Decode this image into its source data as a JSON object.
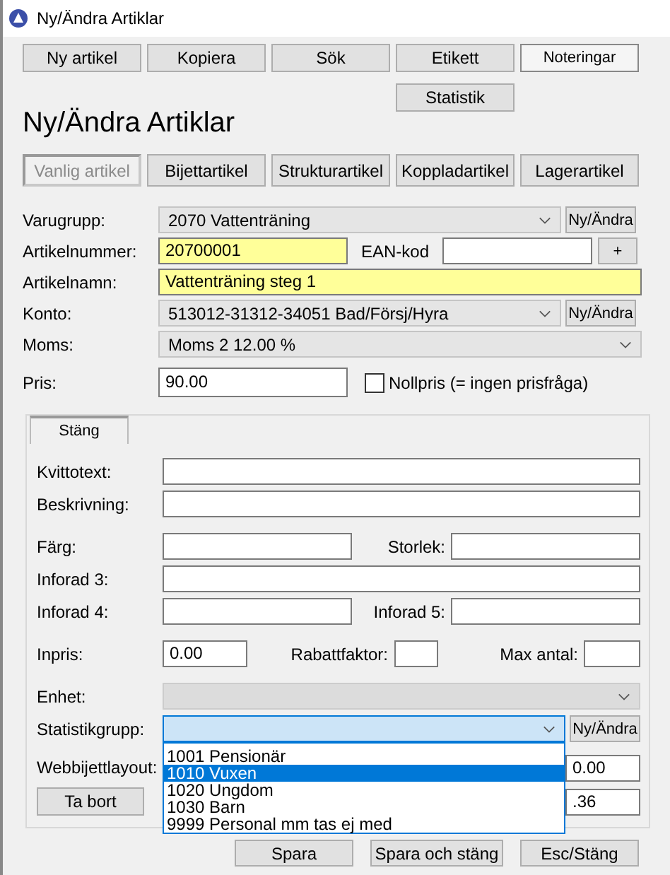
{
  "window": {
    "title": "Ny/Ändra Artiklar"
  },
  "toolbar": [
    {
      "label": "Ny artikel"
    },
    {
      "label": "Kopiera"
    },
    {
      "label": "Sök"
    },
    {
      "label": "Etikett"
    },
    {
      "label": "Noteringar"
    }
  ],
  "statistik_button": "Statistik",
  "heading": "Ny/Ändra Artiklar",
  "tabs": [
    {
      "label": "Vanlig artikel",
      "selected": true
    },
    {
      "label": "Bijettartikel",
      "selected": false
    },
    {
      "label": "Strukturartikel",
      "selected": false
    },
    {
      "label": "Koppladartikel",
      "selected": false
    },
    {
      "label": "Lagerartikel",
      "selected": false
    }
  ],
  "form": {
    "varugrupp": {
      "label": "Varugrupp:",
      "value": "2070 Vattenträning",
      "button": "Ny/Ändra"
    },
    "artikelnummer": {
      "label": "Artikelnummer:",
      "value": "20700001",
      "highlighted": true
    },
    "ean": {
      "label": "EAN-kod",
      "button": "+",
      "highlighted": false
    },
    "artikelnamn": {
      "label": "Artikelnamn:",
      "value": "Vattenträning steg 1",
      "highlighted": true
    },
    "konto": {
      "label": "Konto:",
      "value": "513012-31312-34051 Bad/Försj/Hyra",
      "button": "Ny/Ändra"
    },
    "moms": {
      "label": "Moms:",
      "value": "Moms 2 12.00 %"
    },
    "pris": {
      "label": "Pris:",
      "value": "90.00",
      "highlighted": false
    },
    "nollpris": {
      "label": "Nollpris (= ingen prisfråga)",
      "checked": false
    }
  },
  "panel": {
    "tab": "Stäng",
    "kvittotext": {
      "label": "Kvittotext:"
    },
    "beskrivning": {
      "label": "Beskrivning:"
    },
    "farg": {
      "label": "Färg:"
    },
    "storlek": {
      "label": "Storlek:"
    },
    "inforad3": {
      "label": "Inforad 3:"
    },
    "inforad4": {
      "label": "Inforad 4:"
    },
    "inforad5": {
      "label": "Inforad 5:"
    },
    "inpris": {
      "label": "Inpris:",
      "value": "0.00"
    },
    "rabattfaktor": {
      "label": "Rabattfaktor:"
    },
    "max_antal": {
      "label": "Max antal:"
    },
    "enhet": {
      "label": "Enhet:",
      "disabled": true
    },
    "statistikgrupp": {
      "label": "Statistikgrupp:",
      "button": "Ny/Ändra",
      "open": true,
      "options": [
        {
          "label": "1001 Pensionär",
          "selected": false
        },
        {
          "label": "1010 Vuxen",
          "selected": true
        },
        {
          "label": "1020 Ungdom",
          "selected": false
        },
        {
          "label": "1030 Barn",
          "selected": false
        },
        {
          "label": "9999 Personal mm tas ej med",
          "selected": false
        }
      ]
    },
    "webbijettlayout": {
      "label": "Webbijettlayout:",
      "side_value": "0.00"
    },
    "ta_bort": {
      "label": "Ta bort",
      "side_value": ".36"
    }
  },
  "bottom_buttons": [
    {
      "label": "Spara"
    },
    {
      "label": "Spara och stäng"
    },
    {
      "label": "Esc/Stäng"
    }
  ]
}
